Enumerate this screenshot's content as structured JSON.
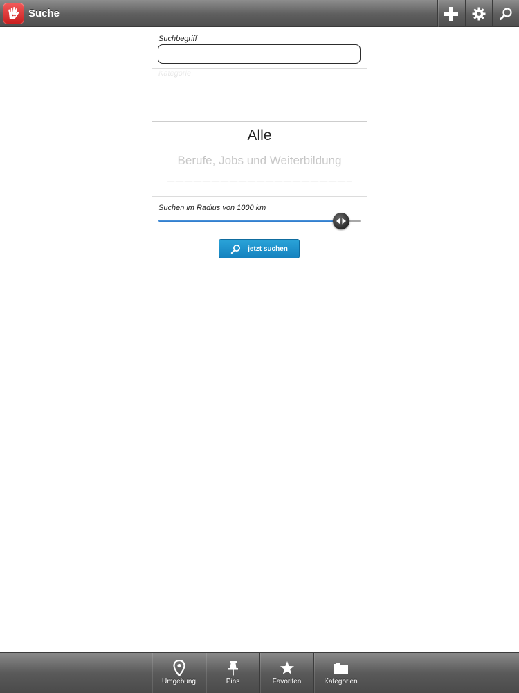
{
  "topbar": {
    "title": "Suche",
    "app_icon": "hand-logo-icon",
    "buttons": [
      {
        "name": "add-button",
        "icon": "plus-icon"
      },
      {
        "name": "settings-button",
        "icon": "gear-icon"
      },
      {
        "name": "search-button",
        "icon": "search-icon"
      }
    ]
  },
  "form": {
    "search_label": "Suchbegriff",
    "search_value": "",
    "category_label": "Kategorie",
    "picker": {
      "selected": "Alle",
      "next": "Berufe, Jobs und Weiterbildung"
    },
    "radius_label": "Suchen im Radius von 1000 km",
    "radius_slider_fraction": 0.87,
    "submit_label": "jetzt suchen"
  },
  "tabbar": {
    "tabs": [
      {
        "label": "Umgebung",
        "icon": "location-pin-icon"
      },
      {
        "label": "Pins",
        "icon": "pushpin-icon"
      },
      {
        "label": "Favoriten",
        "icon": "star-icon"
      },
      {
        "label": "Kategorien",
        "icon": "folder-icon"
      }
    ]
  },
  "colors": {
    "accent": "#1a8fce",
    "slider_fill": "#2a78c9",
    "app_icon": "#d42a2a"
  }
}
